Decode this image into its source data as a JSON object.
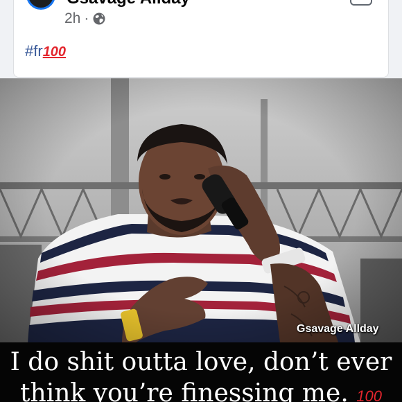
{
  "post": {
    "author": "Gsavage Allday",
    "time": "2h",
    "separator": "·",
    "audience_icon": "globe-icon",
    "text": "#fr",
    "text_emoji": "100"
  },
  "photo": {
    "watermark": "Gsavage Allday"
  },
  "caption": {
    "line1": "I do shit outta love, don’t ever",
    "line2": "think you’re finessing me.",
    "line2_emoji": "100"
  },
  "colors": {
    "link": "#385898",
    "accent": "#1877f2",
    "emoji_red": "#e3252d"
  }
}
